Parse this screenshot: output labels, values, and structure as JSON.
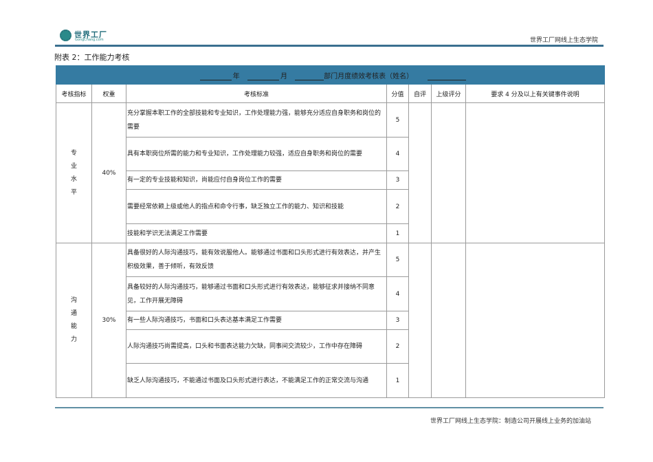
{
  "header": {
    "logo_text": "世界工厂",
    "logo_sub": "GongChang.com",
    "right_text": "世界工厂网线上生态学院"
  },
  "title": "附表 2：工作能力考核",
  "table": {
    "band": {
      "year": "年",
      "month": "月",
      "form_title": "部门月度绩效考核表（姓名）"
    },
    "columns": [
      "考核指标",
      "权重",
      "考核标准",
      "分值",
      "自评",
      "上级评分",
      "要求 4 分及以上有关键事件说明"
    ],
    "groups": [
      {
        "indicator": "专业水平",
        "weight": "40%",
        "rows": [
          {
            "criteria": "充分掌握本职工作的全部技能和专业知识，工作处理能力强，能够充分适应自身职务和岗位的需要",
            "score": "5"
          },
          {
            "criteria": "具有本职岗位所需的能力和专业知识，工作处理能力较强，适应自身职务和岗位的需要",
            "score": "4"
          },
          {
            "criteria": "有一定的专业技能和知识，尚能应付自身岗位工作的需要",
            "score": "3"
          },
          {
            "criteria": "需要经常依赖上级或他人的指点和命令行事，缺乏独立工作的能力、知识和技能",
            "score": "2"
          },
          {
            "criteria": "技能和学识无法满足工作需要",
            "score": "1"
          }
        ]
      },
      {
        "indicator": "沟通能力",
        "weight": "30%",
        "rows": [
          {
            "criteria": "具备很好的人际沟通技巧，能有效说服他人。能够通过书面和口头形式进行有效表达，并产生积极效果，善于倾听，有效反馈",
            "score": "5"
          },
          {
            "criteria": "具备较好的人际沟通技巧，能够通过书面和口头形式进行有效表达，能够征求并接纳不同意见，工作开展无障碍",
            "score": "4"
          },
          {
            "criteria": "有一些人际沟通技巧，书面和口头表达基本满足工作需要",
            "score": "3"
          },
          {
            "criteria": "人际沟通技巧尚需提高，口头和书面表达能力欠缺，同事间交流较少，工作中存在障碍",
            "score": "2"
          },
          {
            "criteria": "缺乏人际沟通技巧，不能通过书面及口头形式进行表达，不能满足工作的正常交流与沟通",
            "score": "1"
          }
        ]
      }
    ]
  },
  "footer": "世界工厂网线上生态学院：制造公司开展线上业务的加油站"
}
